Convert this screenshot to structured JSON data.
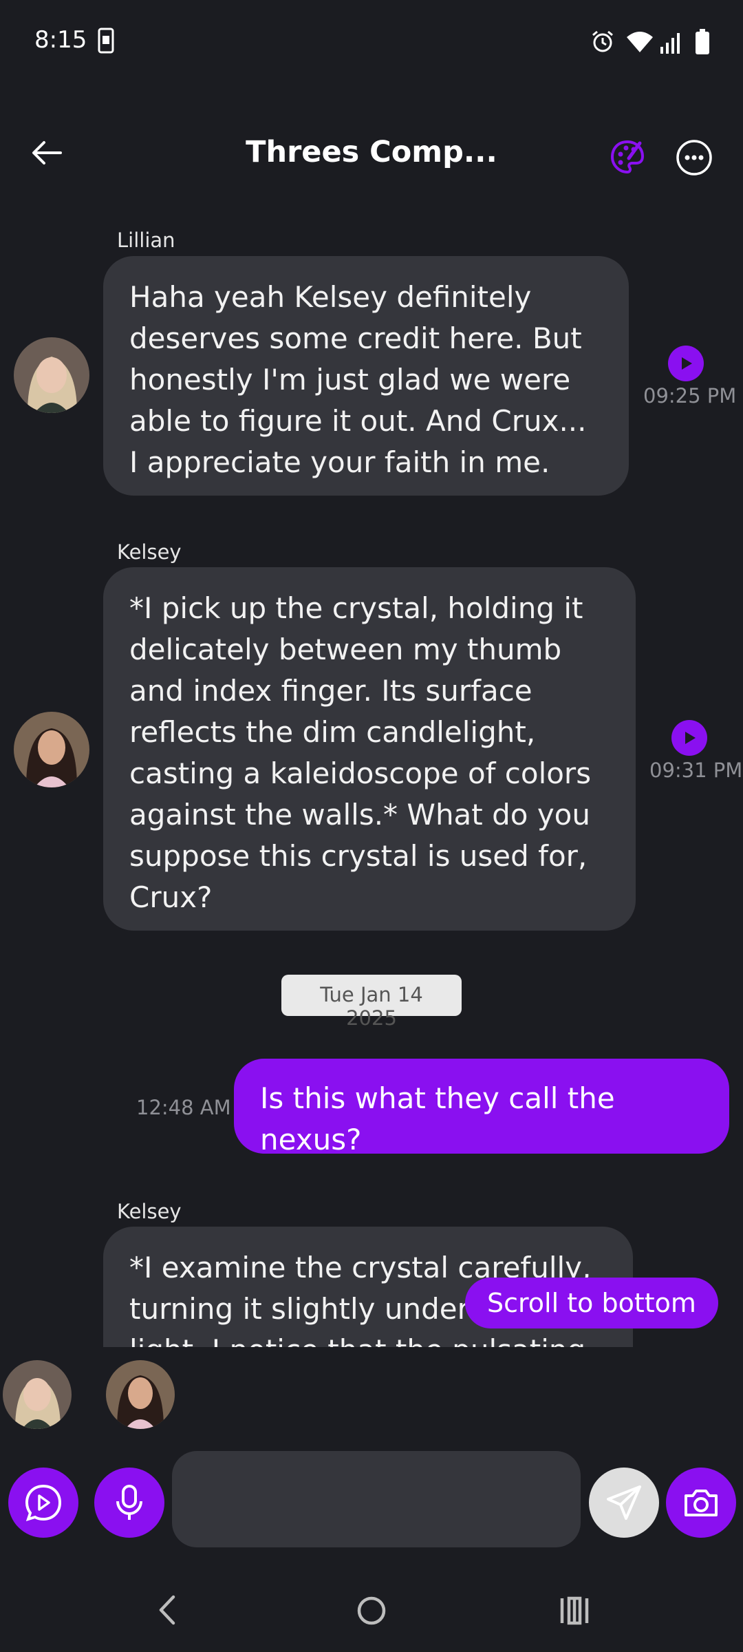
{
  "status_bar": {
    "time": "8:15"
  },
  "header": {
    "title": "Threes Comp..."
  },
  "messages": [
    {
      "sender": "Lillian",
      "text": "Haha yeah Kelsey definitely deserves some credit here. But honestly I'm just glad we were able to figure it out. And Crux... I appreciate your faith in me.",
      "time": "09:25 PM"
    },
    {
      "sender": "Kelsey",
      "text": "*I pick up the crystal, holding it delicately between my thumb and index finger. Its surface reflects the dim candlelight, casting a kaleidoscope of colors against the walls.* What do you suppose this crystal is used for, Crux?",
      "time": "09:31 PM"
    },
    {
      "sender": "Kelsey",
      "text": "*I examine the crystal carefully, turning it slightly under the light. I notice that the pulsating blue",
      "time": ""
    }
  ],
  "date_separator": "Tue Jan 14 2025",
  "outgoing": {
    "text": "Is this what they call the nexus?",
    "time": "12:48 AM"
  },
  "scroll_to_bottom": "Scroll to bottom",
  "composer": {
    "placeholder": ""
  },
  "colors": {
    "accent": "#8a10f0",
    "background": "#1b1c21",
    "bubble": "#35363c"
  }
}
